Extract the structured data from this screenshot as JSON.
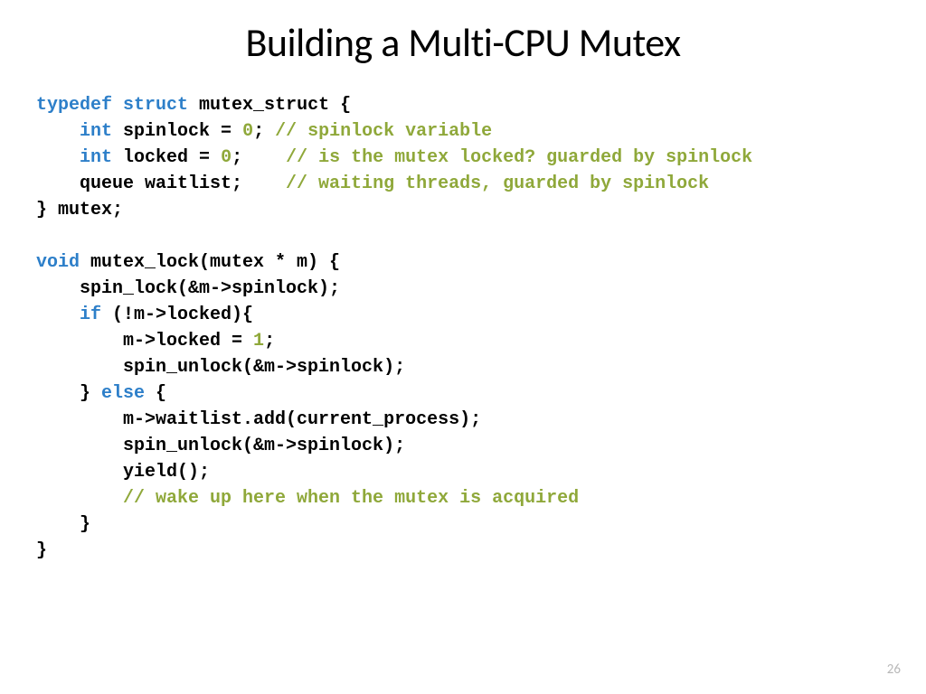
{
  "title": "Building a Multi-CPU Mutex",
  "pageNumber": "26",
  "code": {
    "l1a": "typedef",
    "l1b": "struct",
    "l1c": " mutex_struct {",
    "l2a": "    ",
    "l2b": "int",
    "l2c": " spinlock = ",
    "l2d": "0",
    "l2e": "; ",
    "l2f": "// spinlock variable",
    "l3a": "    ",
    "l3b": "int",
    "l3c": " locked = ",
    "l3d": "0",
    "l3e": ";    ",
    "l3f": "// is the mutex locked? guarded by spinlock",
    "l4a": "    queue waitlist;    ",
    "l4b": "// waiting threads, guarded by spinlock",
    "l5": "} mutex;",
    "l6": "",
    "l7a": "void",
    "l7b": " mutex_lock(mutex * m) {",
    "l8": "    spin_lock(&m->spinlock);",
    "l9a": "    ",
    "l9b": "if",
    "l9c": " (!m->locked){",
    "l10a": "        m->locked = ",
    "l10b": "1",
    "l10c": ";",
    "l11": "        spin_unlock(&m->spinlock);",
    "l12a": "    } ",
    "l12b": "else",
    "l12c": " {",
    "l13": "        m->waitlist.add(current_process);",
    "l14": "        spin_unlock(&m->spinlock);",
    "l15": "        yield();",
    "l16a": "        ",
    "l16b": "// wake up here when the mutex is acquired",
    "l17": "    }",
    "l18": "}"
  }
}
